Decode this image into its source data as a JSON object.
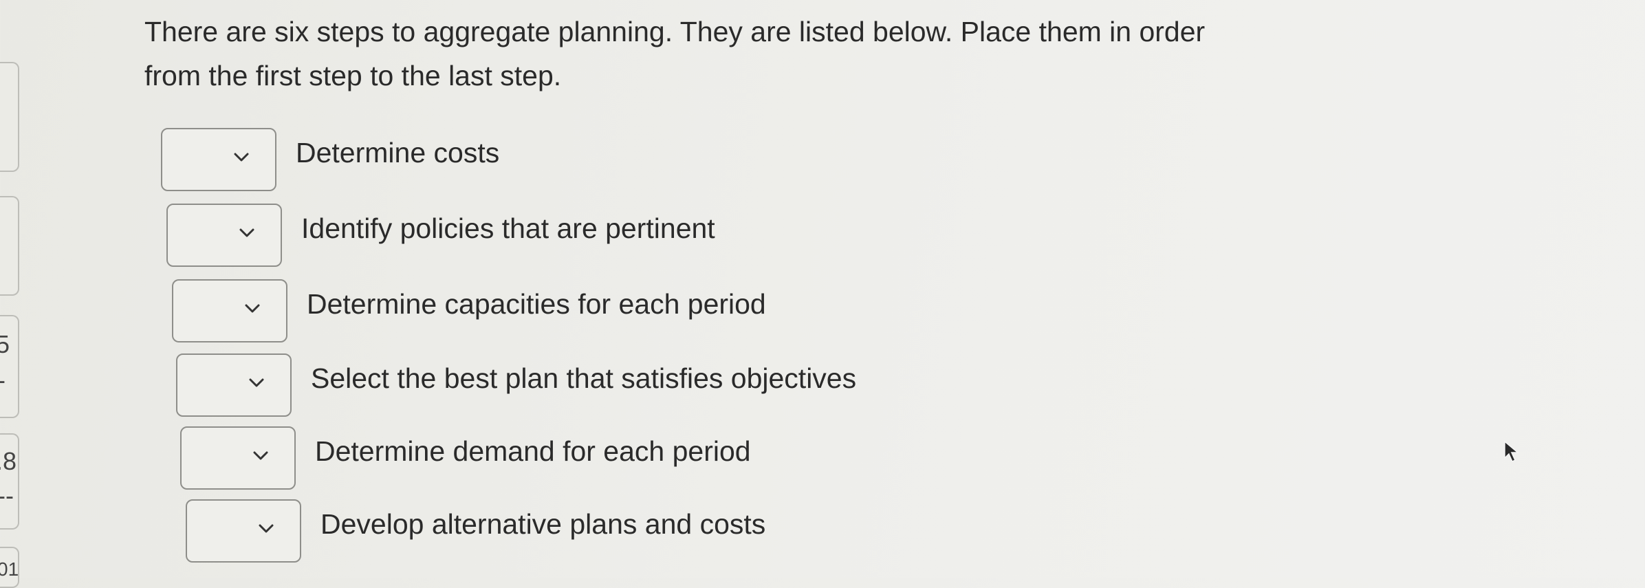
{
  "question": {
    "line1": "There are six steps to aggregate planning. They are listed below. Place them in order",
    "line2": "from the first step to the last step."
  },
  "items": [
    {
      "label": "Determine costs",
      "selected": ""
    },
    {
      "label": "Identify policies that are pertinent",
      "selected": ""
    },
    {
      "label": "Determine capacities for each period",
      "selected": ""
    },
    {
      "label": "Select the best plan that satisfies objectives",
      "selected": ""
    },
    {
      "label": "Determine demand for each period",
      "selected": ""
    },
    {
      "label": "Develop alternative plans and costs",
      "selected": ""
    }
  ],
  "edge": {
    "mark1": "5",
    "mark2": "-",
    "mark3": ".8",
    "mark4": "--",
    "mark5": "01"
  },
  "colors": {
    "background": "#ececE8",
    "text": "#2a2a2a",
    "border": "#8e8e8a"
  },
  "icons": {
    "dropdown": "chevron-down-icon",
    "cursor": "mouse-pointer-icon"
  }
}
